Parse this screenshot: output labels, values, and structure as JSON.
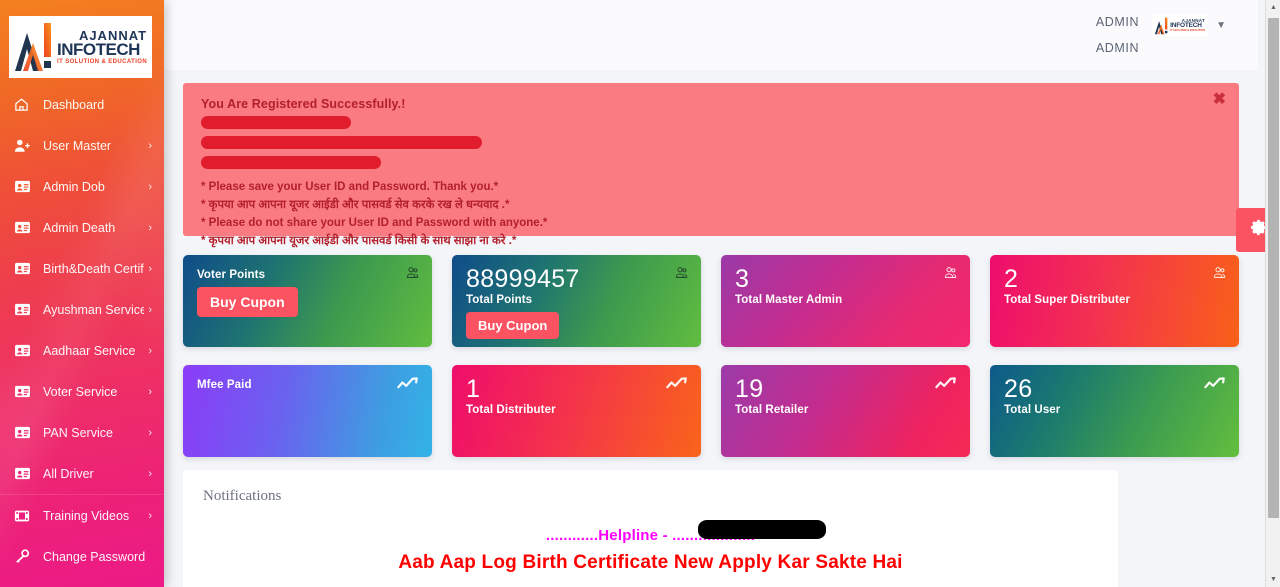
{
  "brand": {
    "line1": "AJANNAT",
    "line2": "INFOTECH",
    "line3": "IT SOLUTION & EDUCATION"
  },
  "sidebar": {
    "items": [
      {
        "label": "Dashboard",
        "icon": "home-icon",
        "caret": ""
      },
      {
        "label": "User Master",
        "icon": "user-add-icon",
        "caret": "›"
      },
      {
        "label": "Admin Dob",
        "icon": "id-card-icon",
        "caret": "›"
      },
      {
        "label": "Admin Death",
        "icon": "id-card-icon",
        "caret": "›"
      },
      {
        "label": "Birth&Death Certificate",
        "icon": "id-card-icon",
        "caret": "›"
      },
      {
        "label": "Ayushman Service",
        "icon": "id-card-icon",
        "caret": "›"
      },
      {
        "label": "Aadhaar Service",
        "icon": "id-card-icon",
        "caret": "›"
      },
      {
        "label": "Voter Service",
        "icon": "id-card-icon",
        "caret": "›"
      },
      {
        "label": "PAN Service",
        "icon": "id-card-icon",
        "caret": "›"
      },
      {
        "label": "All Driver",
        "icon": "id-card-icon",
        "caret": "›"
      },
      {
        "label": "Training Videos",
        "icon": "video-icon",
        "caret": "›"
      },
      {
        "label": "Change Password",
        "icon": "key-icon",
        "caret": ""
      }
    ]
  },
  "header": {
    "user_line1": "ADMIN",
    "user_line2": "ADMIN",
    "dropdown_caret": "▼"
  },
  "alert": {
    "title": "You Are Registered Successfully.!",
    "close_label": "✖",
    "lines": [
      "* Please save your User ID and Password. Thank you.*",
      "* कृपया आप आपना यूजर आईडी और पासवर्ड सेव करके रख ले धन्यवाद .*",
      "* Please do not share your User ID and Password with anyone.*",
      "* कृपया आप आपना यूजर आईडी और पासवर्ड किसी के साथ साझा ना करे .*"
    ]
  },
  "settings_tab": {
    "icon": "gear-icon"
  },
  "cards": {
    "row1": [
      {
        "value": "",
        "label": "Voter Points",
        "icon": "users-icon",
        "button": "Buy Cupon",
        "accent": "#fb5362"
      },
      {
        "value": "88999457",
        "label": "Total Points",
        "icon": "users-icon",
        "button": "Buy Cupon",
        "accent": "#fb5362"
      },
      {
        "value": "3",
        "label": "Total Master Admin",
        "icon": "users-icon",
        "button": "",
        "accent": ""
      },
      {
        "value": "2",
        "label": "Total Super Distributer",
        "icon": "users-icon",
        "button": "",
        "accent": ""
      }
    ],
    "row2": [
      {
        "value": "",
        "label": "Mfee Paid",
        "icon": "chart-line-icon"
      },
      {
        "value": "1",
        "label": "Total Distributer",
        "icon": "chart-line-icon"
      },
      {
        "value": "19",
        "label": "Total Retailer",
        "icon": "chart-line-icon"
      },
      {
        "value": "26",
        "label": "Total User",
        "icon": "chart-line-icon"
      }
    ]
  },
  "notifications": {
    "title": "Notifications",
    "helpline_prefix": "............Helpline - ",
    "helpline_suffix": "...................",
    "marquee": "Aab Aap Log Birth Certificate New Apply Kar Sakte Hai"
  },
  "scrollbar": {
    "up": "▲",
    "down": "▼"
  }
}
